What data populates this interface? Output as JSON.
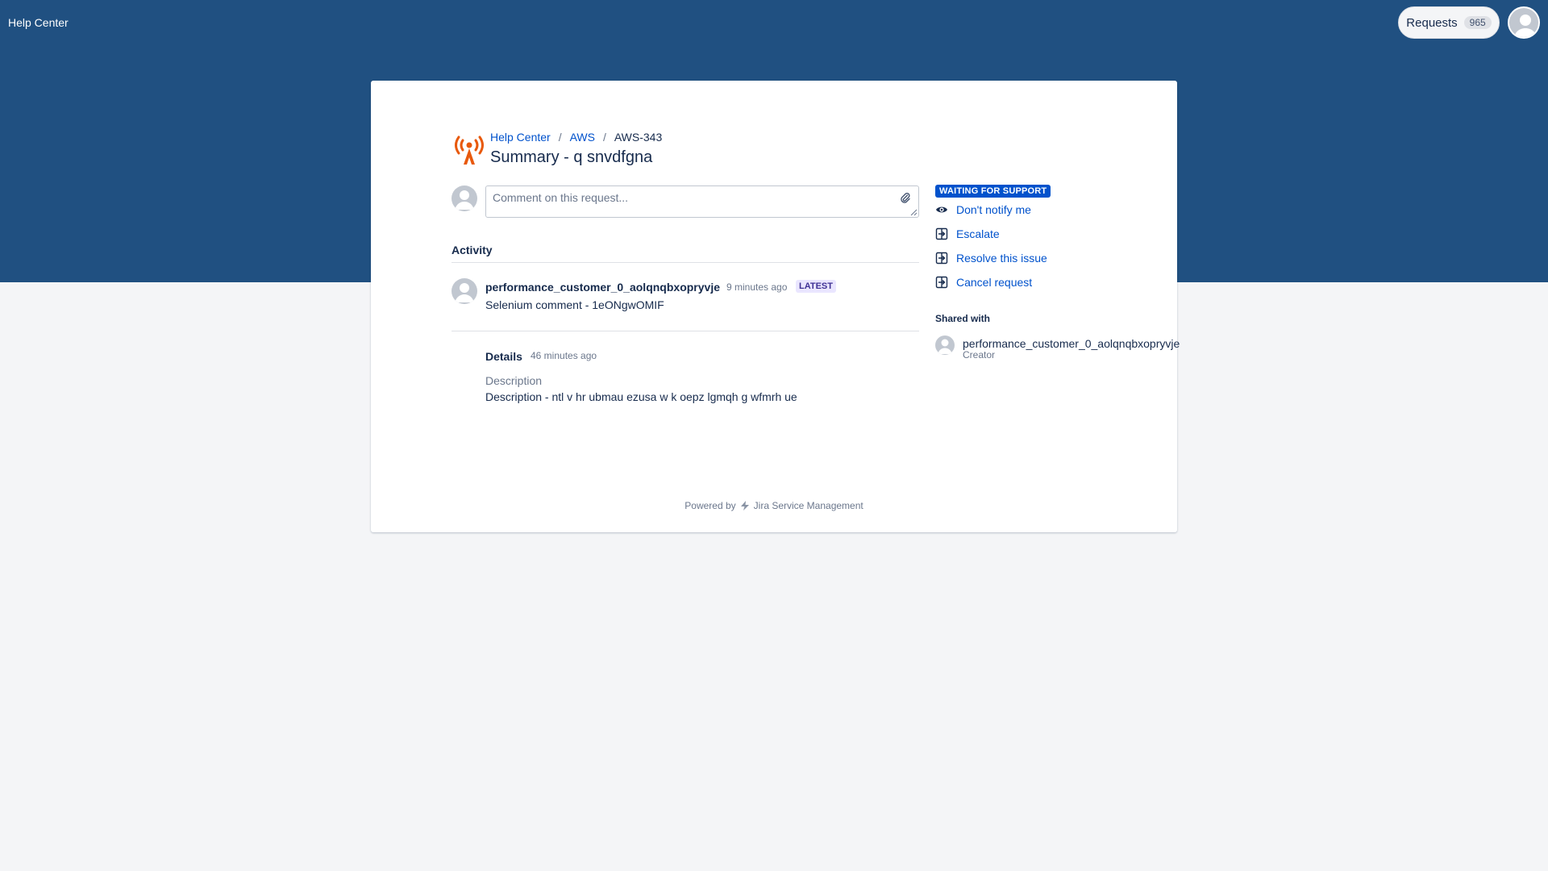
{
  "header": {
    "brand": "Help Center",
    "requests_label": "Requests",
    "requests_count": "965"
  },
  "breadcrumb": {
    "items": [
      "Help Center",
      "AWS"
    ],
    "current": "AWS-343",
    "separator": "/"
  },
  "request": {
    "title": "Summary - q snvdfgna",
    "comment_placeholder": "Comment on this request..."
  },
  "activity": {
    "heading": "Activity",
    "author": "performance_customer_0_aolqnqbxopryvje",
    "time": "9 minutes ago",
    "badge": "LATEST",
    "comment": "Selenium comment - 1eONgwOMIF"
  },
  "details": {
    "heading": "Details",
    "time": "46 minutes ago",
    "field_label": "Description",
    "field_value": "Description - ntl v hr ubmau ezusa w k oepz lgmqh g wfmrh ue"
  },
  "sidebar": {
    "status": "WAITING FOR SUPPORT",
    "actions": [
      "Don't notify me",
      "Escalate",
      "Resolve this issue",
      "Cancel request"
    ],
    "shared_heading": "Shared with",
    "shared_name": "performance_customer_0_aolqnqbxopryvje",
    "shared_role": "Creator"
  },
  "footer": {
    "powered_by": "Powered by",
    "product": "Jira Service Management"
  },
  "colors": {
    "banner": "#205081",
    "link": "#0052cc",
    "status_badge": "#0052cc",
    "latest_badge_bg": "#eae6ff",
    "project_icon": "#e8590c"
  },
  "icons": {
    "project": "broadcast-tower-icon",
    "attach": "paperclip-icon",
    "watch": "eye-icon",
    "transition": "transition-arrow-icon",
    "footer": "jira-service-management-icon",
    "avatar": "default-user-avatar"
  }
}
